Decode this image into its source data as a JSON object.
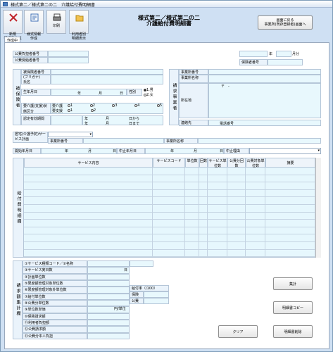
{
  "window": {
    "title": "様式第二／様式第二の二　介護給付費明細書"
  },
  "toolbar": {
    "new": "新規\n明細書作成",
    "copy": "様式情報\n作成",
    "print": "印刷",
    "list": "利用者別\n明細表示"
  },
  "header": {
    "title_line1": "様式第二／様式第二の二",
    "title_line2": "介護給付費明細書",
    "back_button": "画面に戻る\n事業所(既存登録者)画面へ"
  },
  "tabs": [
    {
      "label": "作成中"
    }
  ],
  "top": {
    "insurer_label": "公費負担者番号",
    "recipient_label": "公費受給者番号",
    "year_label": "年",
    "month_label": "月分",
    "insurer_no_label": "保険者番号"
  },
  "insured": {
    "section": "被保険者",
    "no_label": "被保険者番号",
    "kana_label": "(フリガナ)",
    "name_label": "氏名",
    "birth_label": "生年月日",
    "year": "年",
    "month": "月",
    "day": "日",
    "sex_label": "性別",
    "sex_m": "1.男",
    "sex_f": "2.女",
    "care_label": "要介護(支援)状態区分",
    "care_sub1": "要介護",
    "care_sub2": "要支援",
    "care_nums": [
      "1",
      "2",
      "3",
      "4",
      "5"
    ],
    "support_nums": [
      "1",
      "2"
    ],
    "cert_label": "認定有効期間",
    "from": "日から",
    "to": "日まで"
  },
  "provider": {
    "section": "請求事業者",
    "no_label": "事業所番号",
    "name_label": "事業所名称",
    "zip": "〒　-",
    "address_label": "所在地",
    "contact_label": "連絡先",
    "tel_label": "電話番号"
  },
  "plan": {
    "home_label": "居宅(介護予防)サービス計画",
    "office_no": "事業所番号",
    "office_name": "事業所名称",
    "start_label": "開始年月日",
    "stop_label": "中止年月日",
    "stop_reason": "中止理由",
    "y": "年",
    "m": "月",
    "d": "日"
  },
  "detail": {
    "section": "給付費明細欄",
    "columns": [
      "サービス内容",
      "サービスコード",
      "単位数",
      "回数",
      "サービス単位数",
      "公費分回数",
      "公費対象単位数",
      "摘要"
    ]
  },
  "claim": {
    "section": "請求額集計欄",
    "rows": [
      "①サービス種類コード／②名称",
      "③サービス実日数",
      "④計画単位数",
      "⑤限度額管理対象単位数",
      "⑥限度額管理対象外単位数",
      "⑦給付単位数",
      "⑧公費分単位数",
      "⑨単位数単価",
      "⑩保険請求額",
      "⑪利用者負担額",
      "⑫公費請求額",
      "⑬公費分本人負担"
    ],
    "day_unit": "日",
    "price_unit": "円/単位",
    "rate_label": "給付率（/100）",
    "insurance_label": "保険",
    "public_label": "公費"
  },
  "buttons": {
    "calc": "集計",
    "copy": "明細書コピー",
    "clear": "クリア",
    "delete": "明細書削除"
  },
  "colors": {
    "accent": "#7f9db9",
    "field": "#e6f7fd"
  }
}
